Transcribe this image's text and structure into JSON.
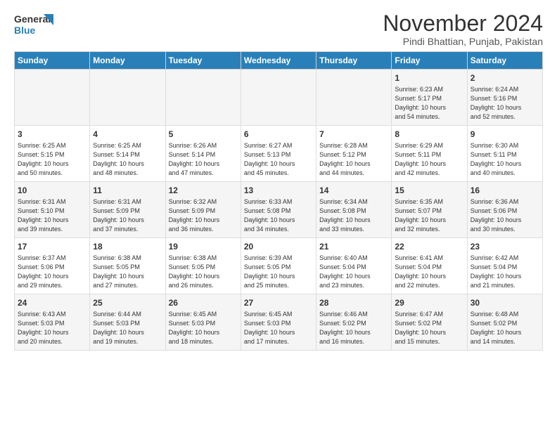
{
  "logo": {
    "line1": "General",
    "line2": "Blue"
  },
  "title": "November 2024",
  "subtitle": "Pindi Bhattian, Punjab, Pakistan",
  "headers": [
    "Sunday",
    "Monday",
    "Tuesday",
    "Wednesday",
    "Thursday",
    "Friday",
    "Saturday"
  ],
  "weeks": [
    [
      {
        "day": "",
        "info": ""
      },
      {
        "day": "",
        "info": ""
      },
      {
        "day": "",
        "info": ""
      },
      {
        "day": "",
        "info": ""
      },
      {
        "day": "",
        "info": ""
      },
      {
        "day": "1",
        "info": "Sunrise: 6:23 AM\nSunset: 5:17 PM\nDaylight: 10 hours\nand 54 minutes."
      },
      {
        "day": "2",
        "info": "Sunrise: 6:24 AM\nSunset: 5:16 PM\nDaylight: 10 hours\nand 52 minutes."
      }
    ],
    [
      {
        "day": "3",
        "info": "Sunrise: 6:25 AM\nSunset: 5:15 PM\nDaylight: 10 hours\nand 50 minutes."
      },
      {
        "day": "4",
        "info": "Sunrise: 6:25 AM\nSunset: 5:14 PM\nDaylight: 10 hours\nand 48 minutes."
      },
      {
        "day": "5",
        "info": "Sunrise: 6:26 AM\nSunset: 5:14 PM\nDaylight: 10 hours\nand 47 minutes."
      },
      {
        "day": "6",
        "info": "Sunrise: 6:27 AM\nSunset: 5:13 PM\nDaylight: 10 hours\nand 45 minutes."
      },
      {
        "day": "7",
        "info": "Sunrise: 6:28 AM\nSunset: 5:12 PM\nDaylight: 10 hours\nand 44 minutes."
      },
      {
        "day": "8",
        "info": "Sunrise: 6:29 AM\nSunset: 5:11 PM\nDaylight: 10 hours\nand 42 minutes."
      },
      {
        "day": "9",
        "info": "Sunrise: 6:30 AM\nSunset: 5:11 PM\nDaylight: 10 hours\nand 40 minutes."
      }
    ],
    [
      {
        "day": "10",
        "info": "Sunrise: 6:31 AM\nSunset: 5:10 PM\nDaylight: 10 hours\nand 39 minutes."
      },
      {
        "day": "11",
        "info": "Sunrise: 6:31 AM\nSunset: 5:09 PM\nDaylight: 10 hours\nand 37 minutes."
      },
      {
        "day": "12",
        "info": "Sunrise: 6:32 AM\nSunset: 5:09 PM\nDaylight: 10 hours\nand 36 minutes."
      },
      {
        "day": "13",
        "info": "Sunrise: 6:33 AM\nSunset: 5:08 PM\nDaylight: 10 hours\nand 34 minutes."
      },
      {
        "day": "14",
        "info": "Sunrise: 6:34 AM\nSunset: 5:08 PM\nDaylight: 10 hours\nand 33 minutes."
      },
      {
        "day": "15",
        "info": "Sunrise: 6:35 AM\nSunset: 5:07 PM\nDaylight: 10 hours\nand 32 minutes."
      },
      {
        "day": "16",
        "info": "Sunrise: 6:36 AM\nSunset: 5:06 PM\nDaylight: 10 hours\nand 30 minutes."
      }
    ],
    [
      {
        "day": "17",
        "info": "Sunrise: 6:37 AM\nSunset: 5:06 PM\nDaylight: 10 hours\nand 29 minutes."
      },
      {
        "day": "18",
        "info": "Sunrise: 6:38 AM\nSunset: 5:05 PM\nDaylight: 10 hours\nand 27 minutes."
      },
      {
        "day": "19",
        "info": "Sunrise: 6:38 AM\nSunset: 5:05 PM\nDaylight: 10 hours\nand 26 minutes."
      },
      {
        "day": "20",
        "info": "Sunrise: 6:39 AM\nSunset: 5:05 PM\nDaylight: 10 hours\nand 25 minutes."
      },
      {
        "day": "21",
        "info": "Sunrise: 6:40 AM\nSunset: 5:04 PM\nDaylight: 10 hours\nand 23 minutes."
      },
      {
        "day": "22",
        "info": "Sunrise: 6:41 AM\nSunset: 5:04 PM\nDaylight: 10 hours\nand 22 minutes."
      },
      {
        "day": "23",
        "info": "Sunrise: 6:42 AM\nSunset: 5:04 PM\nDaylight: 10 hours\nand 21 minutes."
      }
    ],
    [
      {
        "day": "24",
        "info": "Sunrise: 6:43 AM\nSunset: 5:03 PM\nDaylight: 10 hours\nand 20 minutes."
      },
      {
        "day": "25",
        "info": "Sunrise: 6:44 AM\nSunset: 5:03 PM\nDaylight: 10 hours\nand 19 minutes."
      },
      {
        "day": "26",
        "info": "Sunrise: 6:45 AM\nSunset: 5:03 PM\nDaylight: 10 hours\nand 18 minutes."
      },
      {
        "day": "27",
        "info": "Sunrise: 6:45 AM\nSunset: 5:03 PM\nDaylight: 10 hours\nand 17 minutes."
      },
      {
        "day": "28",
        "info": "Sunrise: 6:46 AM\nSunset: 5:02 PM\nDaylight: 10 hours\nand 16 minutes."
      },
      {
        "day": "29",
        "info": "Sunrise: 6:47 AM\nSunset: 5:02 PM\nDaylight: 10 hours\nand 15 minutes."
      },
      {
        "day": "30",
        "info": "Sunrise: 6:48 AM\nSunset: 5:02 PM\nDaylight: 10 hours\nand 14 minutes."
      }
    ]
  ]
}
